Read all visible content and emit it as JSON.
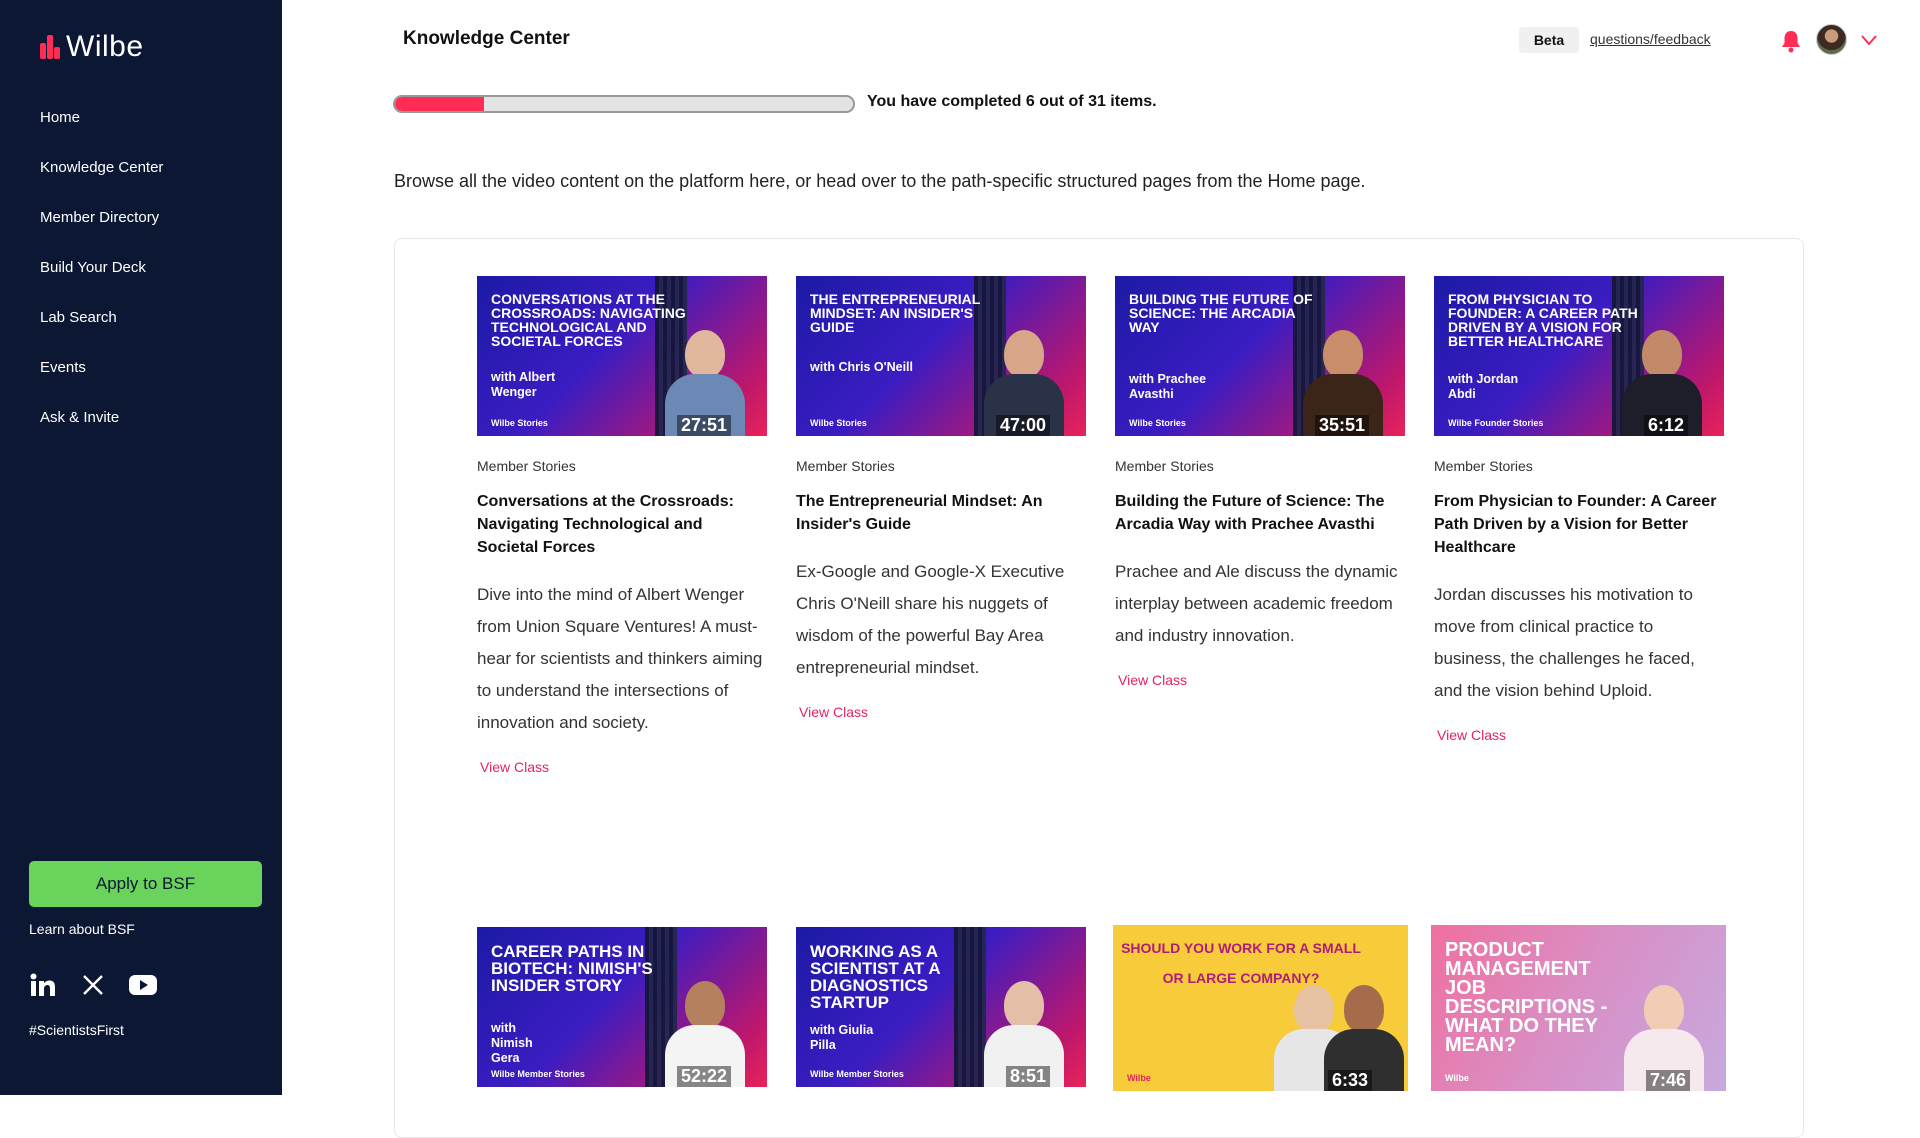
{
  "sidebar": {
    "logo_text": "Wilbe",
    "nav": [
      "Home",
      "Knowledge Center",
      "Member Directory",
      "Build Your Deck",
      "Lab Search",
      "Events",
      "Ask & Invite"
    ],
    "apply_label": "Apply to BSF",
    "learn_label": "Learn about BSF",
    "hashtag": "#ScientistsFirst",
    "socials": [
      "linkedin-icon",
      "x-icon",
      "youtube-icon"
    ]
  },
  "header": {
    "title": "Knowledge Center",
    "beta": "Beta",
    "feedback": "questions/feedback"
  },
  "progress": {
    "completed": 6,
    "total": 31,
    "text": "You have completed 6 out of 31 items."
  },
  "intro": "Browse all the video content on the platform here, or head over to the path-specific structured pages from the Home page.",
  "colors": {
    "accent": "#ff2d55",
    "sidebar_bg": "#0b1733",
    "apply_bg": "#6ad35c",
    "link": "#e5245e"
  },
  "cards": [
    {
      "thumb_title": "Conversations at the Crossroads: Navigating Technological and Societal Forces",
      "thumb_with": "with Albert Wenger",
      "thumb_brand": "Wilbe Stories",
      "duration": "27:51",
      "category": "Member Stories",
      "title": "Conversations at the Crossroads: Navigating Technological and Societal Forces",
      "description": "Dive into the mind of Albert Wenger from Union Square Ventures! A must-hear for scientists and thinkers aiming to understand the intersections of innovation and society.",
      "cta": "View Class"
    },
    {
      "thumb_title": "The Entrepreneurial Mindset: An Insider's Guide",
      "thumb_with": "with Chris O'Neill",
      "thumb_brand": "Wilbe Stories",
      "duration": "47:00",
      "category": "Member Stories",
      "title": "The Entrepreneurial Mindset: An Insider's Guide",
      "description": "Ex-Google and Google-X Executive Chris O'Neill share his nuggets of wisdom of the powerful Bay Area entrepreneurial mindset.",
      "cta": "View Class"
    },
    {
      "thumb_title": "Building the Future of Science: The Arcadia Way",
      "thumb_with": "with Prachee Avasthi",
      "thumb_brand": "Wilbe Stories",
      "duration": "35:51",
      "category": "Member Stories",
      "title": "Building the Future of Science: The Arcadia Way with Prachee Avasthi",
      "description": "Prachee and Ale discuss the dynamic interplay between academic freedom and industry innovation.",
      "cta": "View Class"
    },
    {
      "thumb_title": "From Physician to Founder: A Career Path Driven by a Vision for Better Healthcare",
      "thumb_with": "with Jordan Abdi",
      "thumb_brand": "Wilbe Founder Stories",
      "duration": "6:12",
      "category": "Member Stories",
      "title": "From Physician to Founder: A Career Path Driven by a Vision for Better Healthcare",
      "description": "Jordan discusses his motivation to move from clinical practice to business, the challenges he faced, and the vision behind Uploid.",
      "cta": "View Class"
    }
  ],
  "cards_row2": [
    {
      "thumb_title": "Career Paths in Biotech: Nimish's Insider Story",
      "thumb_with": "with Nimish Gera",
      "thumb_brand": "Wilbe Member Stories",
      "duration": "52:22"
    },
    {
      "thumb_title": "Working as a Scientist at a Diagnostics Startup",
      "thumb_with": "with Giulia Pilla",
      "thumb_brand": "Wilbe Member Stories",
      "duration": "8:51"
    },
    {
      "thumb_title": "Should you work for a Small or Large Company?",
      "thumb_with": "",
      "thumb_brand": "Wilbe",
      "duration": "6:33"
    },
    {
      "thumb_title": "Product Management Job Descriptions - What do they mean?",
      "thumb_with": "",
      "thumb_brand": "Wilbe",
      "duration": "7:46"
    }
  ]
}
